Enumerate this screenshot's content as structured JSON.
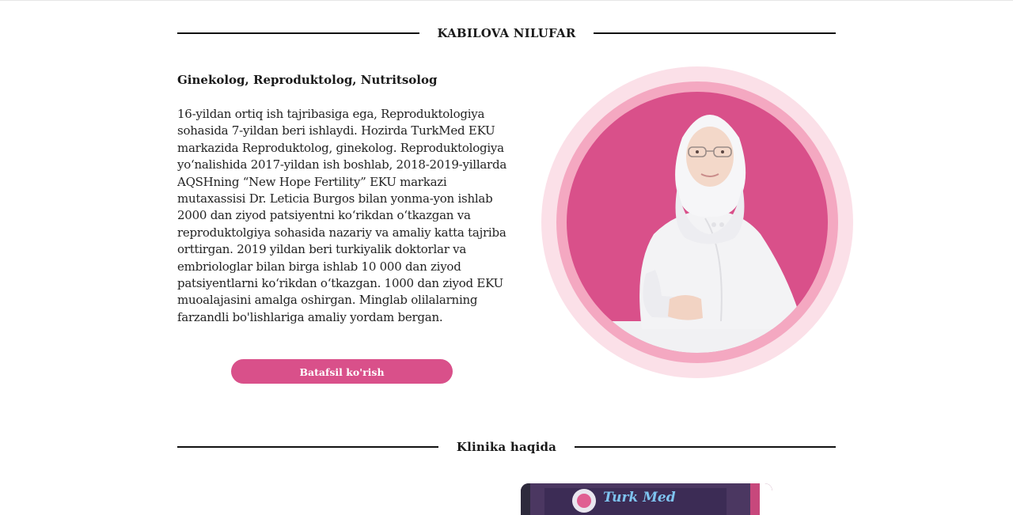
{
  "doctor": {
    "name": "KABILOVA NILUFAR",
    "specialty": "Ginekolog, Reproduktolog, Nutritsolog",
    "bio": "16-yildan ortiq ish tajribasiga ega, Reproduktologiya sohasida 7-yildan beri ishlaydi. Hozirda TurkMed EKU markazida Reproduktolog, ginekolog. Reproduktologiya yo‘nalishida 2017-yildan ish boshlab, 2018-2019-yillarda AQSHning “New Hope Fertility” EKU markazi mutaxassisi Dr. Leticia Burgos bilan yonma-yon ishlab 2000 dan ziyod patsiyentni ko‘rikdan o‘tkazgan va reproduktolgiya sohasida nazariy va amaliy katta tajriba orttirgan. 2019 yildan beri turkiyalik doktorlar va embriologlar bilan birga ishlab 10 000 dan ziyod patsiyentlarni ko‘rikdan o‘tkazgan. 1000 dan ziyod EKU muoalajasini amalga oshirgan. Minglab olilalarning farzandli bo'lishlariga amaliy yordam bergan.",
    "button_label": "Batafsil ko'rish"
  },
  "clinic": {
    "section_title": "Klinika haqida",
    "sign_text": "Turk Med"
  },
  "colors": {
    "accent": "#d9508a",
    "ring_outer": "#fbe0e8",
    "ring_mid": "#f4a8c1"
  }
}
